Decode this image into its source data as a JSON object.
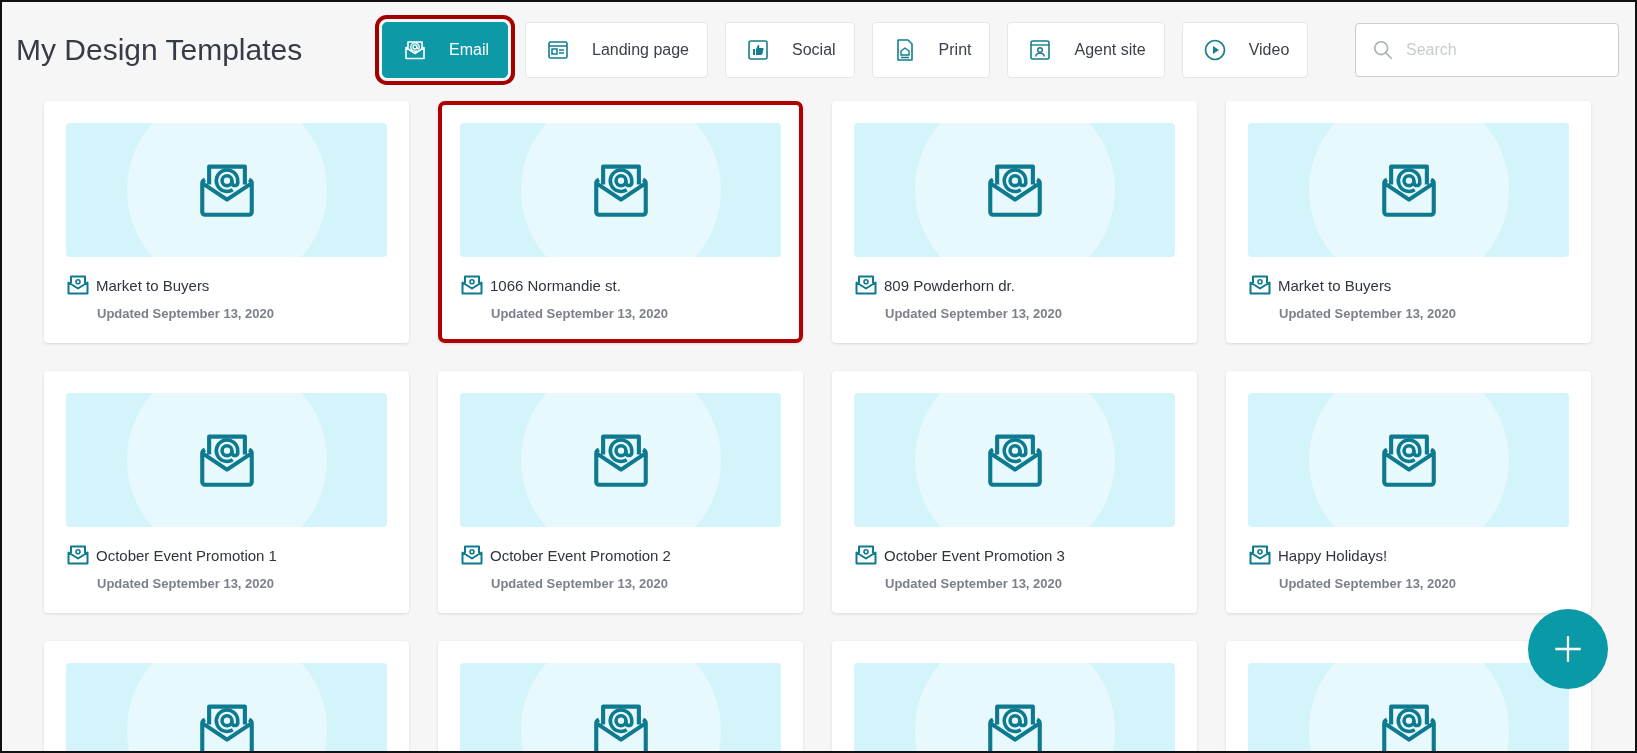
{
  "title": "My Design Templates",
  "tabs": [
    {
      "label": "Email",
      "kind": "email",
      "selected": true,
      "highlighted": true
    },
    {
      "label": "Landing page",
      "kind": "landing",
      "selected": false,
      "highlighted": false
    },
    {
      "label": "Social",
      "kind": "social",
      "selected": false,
      "highlighted": false
    },
    {
      "label": "Print",
      "kind": "print",
      "selected": false,
      "highlighted": false
    },
    {
      "label": "Agent site",
      "kind": "agent",
      "selected": false,
      "highlighted": false
    },
    {
      "label": "Video",
      "kind": "video",
      "selected": false,
      "highlighted": false
    }
  ],
  "search": {
    "placeholder": "Search"
  },
  "cards": [
    {
      "kind": "full",
      "name": "Market to Buyers",
      "updated": "Updated September 13, 2020",
      "highlighted": false
    },
    {
      "kind": "full",
      "name": "1066 Normandie st.",
      "updated": "Updated September 13, 2020",
      "highlighted": true
    },
    {
      "kind": "full",
      "name": "809 Powderhorn dr.",
      "updated": "Updated September 13, 2020",
      "highlighted": false
    },
    {
      "kind": "full",
      "name": "Market to Buyers",
      "updated": "Updated September 13, 2020",
      "highlighted": false
    },
    {
      "kind": "full",
      "name": "October Event Promotion 1",
      "updated": "Updated September 13, 2020",
      "highlighted": false
    },
    {
      "kind": "full",
      "name": "October Event Promotion 2",
      "updated": "Updated September 13, 2020",
      "highlighted": false
    },
    {
      "kind": "full",
      "name": "October Event Promotion 3",
      "updated": "Updated September 13, 2020",
      "highlighted": false
    },
    {
      "kind": "full",
      "name": "Happy Holidays!",
      "updated": "Updated September 13, 2020",
      "highlighted": false
    },
    {
      "kind": "cut",
      "highlighted": false
    },
    {
      "kind": "cut",
      "highlighted": false
    },
    {
      "kind": "cut",
      "highlighted": false
    },
    {
      "kind": "cut",
      "highlighted": false
    }
  ]
}
